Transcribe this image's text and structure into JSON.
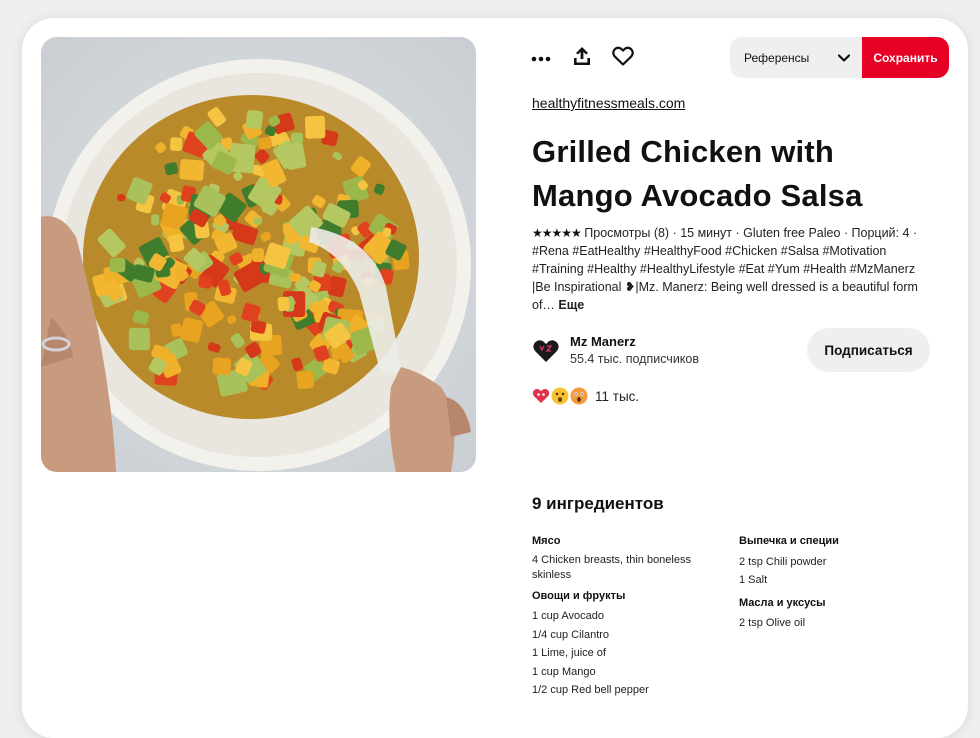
{
  "toolbar": {
    "more_icon": "ellipsis-icon",
    "share_icon": "share-upload-icon",
    "like_icon": "heart-icon",
    "board_label": "Референсы",
    "save_label": "Сохранить"
  },
  "pin": {
    "source": "healthyfitnessmeals.com",
    "title": "Grilled Chicken with Mango Avocado Salsa",
    "stars": "★★★★★",
    "description": " Просмотры (8) · 15 минут · Gluten free Paleo · Порций: 4 · #Rena #EatHealthy #HealthyFood #Chicken #Salsa #Motivation #Training #Healthy #HealthyLifestyle #Eat #Yum #Health #MzManerz |Be Inspirational ❥|Mz. Manerz: Being well dressed is a beautiful form of… ",
    "more_label": "Еще"
  },
  "creator": {
    "name": "Mz Manerz",
    "followers": "55.4 тыс. подписчиков",
    "follow_label": "Подписаться"
  },
  "reactions": {
    "icons": [
      "heart-eyes-icon",
      "wow-icon",
      "surprised-icon"
    ],
    "count": "11 тыс."
  },
  "ingredients": {
    "title": "9 ингредиентов",
    "left": [
      {
        "category": "Мясо",
        "items": [
          "4 Chicken breasts, thin boneless skinless"
        ]
      },
      {
        "category": "Овощи и фрукты",
        "items": [
          "1 cup Avocado",
          "1/4 cup Cilantro",
          "1 Lime, juice of",
          "1 cup Mango",
          "1/2 cup Red bell pepper"
        ]
      }
    ],
    "right": [
      {
        "category": "Выпечка и специи",
        "items": [
          "2 tsp Chili powder",
          "1 Salt"
        ]
      },
      {
        "category": "Масла и уксусы",
        "items": [
          "2 tsp Olive oil"
        ]
      }
    ]
  },
  "colors": {
    "accent": "#e60023",
    "page_bg": "#efefef",
    "button_bg": "#efefef"
  }
}
